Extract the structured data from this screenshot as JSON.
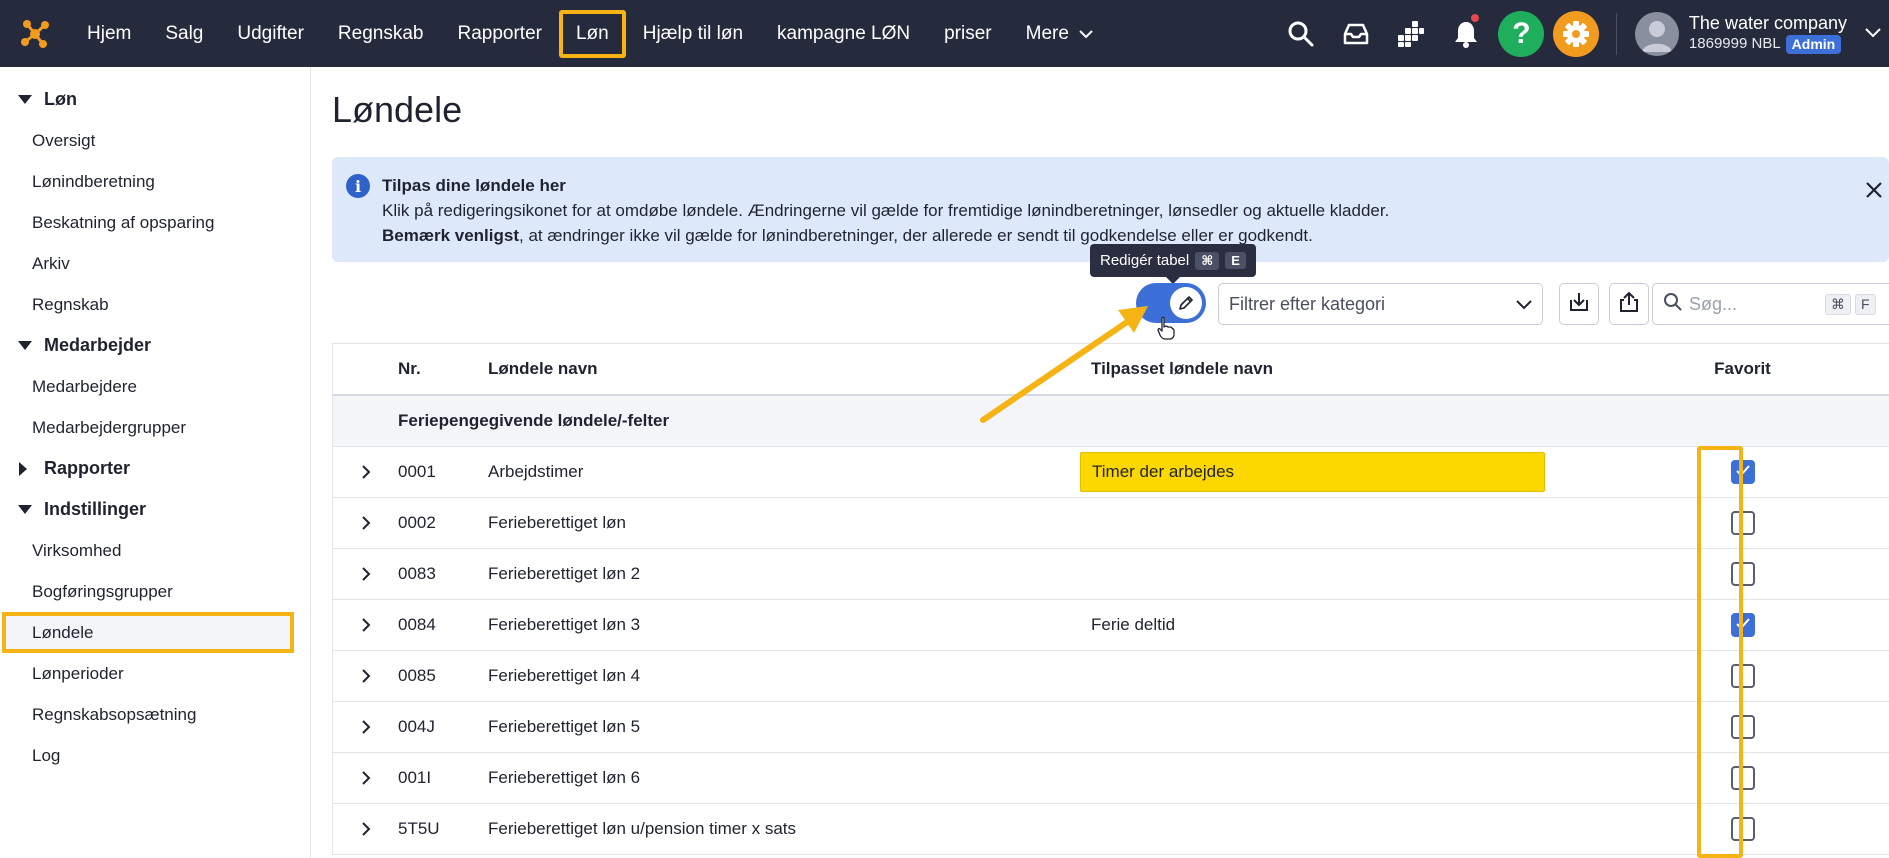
{
  "nav": {
    "items": [
      {
        "label": "Hjem"
      },
      {
        "label": "Salg"
      },
      {
        "label": "Udgifter"
      },
      {
        "label": "Regnskab"
      },
      {
        "label": "Rapporter"
      },
      {
        "label": "Løn",
        "active": true
      },
      {
        "label": "Hjælp til løn"
      },
      {
        "label": "kampagne LØN"
      },
      {
        "label": "priser"
      },
      {
        "label": "Mere"
      }
    ],
    "company_name": "The water company",
    "company_id": "1869999 NBL",
    "role_badge": "Admin",
    "colors": {
      "bar": "#262a3d",
      "help": "#1fae5b",
      "settings": "#f29c1f",
      "highlight": "#f5b414"
    }
  },
  "sidebar": {
    "sections": [
      {
        "label": "Løn",
        "expanded": true,
        "items": [
          "Oversigt",
          "Lønindberetning",
          "Beskatning af opsparing",
          "Arkiv",
          "Regnskab"
        ]
      },
      {
        "label": "Medarbejder",
        "expanded": true,
        "items": [
          "Medarbejdere",
          "Medarbejdergrupper"
        ]
      },
      {
        "label": "Rapporter",
        "expanded": false,
        "items": []
      },
      {
        "label": "Indstillinger",
        "expanded": true,
        "items": [
          "Virksomhed",
          "Bogføringsgrupper",
          "Løndele",
          "Lønperioder",
          "Regnskabsopsætning",
          "Log"
        ]
      }
    ],
    "active_item": "Løndele"
  },
  "page": {
    "title": "Løndele"
  },
  "info": {
    "heading": "Tilpas dine løndele her",
    "line1": "Klik på redigeringsikonet for at omdøbe løndele. Ændringerne vil gælde for fremtidige lønindberetninger, lønsedler og aktuelle kladder.",
    "note_bold": "Bemærk venligst",
    "note_rest": ", at ændringer ikke vil gælde for lønindberetninger, der allerede er sendt til godkendelse eller er godkendt."
  },
  "toolbar": {
    "tooltip": "Redigér tabel",
    "tooltip_key1": "⌘",
    "tooltip_key2": "E",
    "edit_toggle_on": true,
    "filter_placeholder": "Filtrer efter kategori",
    "search_placeholder": "Søg...",
    "search_key1": "⌘",
    "search_key2": "F"
  },
  "table": {
    "headers": {
      "nr": "Nr.",
      "name": "Løndele navn",
      "custom": "Tilpasset løndele navn",
      "fav": "Favorit"
    },
    "group": "Feriepengegivende løndele/-felter",
    "rows": [
      {
        "nr": "0001",
        "name": "Arbejdstimer",
        "custom": "Timer der arbejdes",
        "fav": true,
        "editing": true
      },
      {
        "nr": "0002",
        "name": "Ferieberettiget løn",
        "custom": "",
        "fav": false
      },
      {
        "nr": "0083",
        "name": "Ferieberettiget løn 2",
        "custom": "",
        "fav": false
      },
      {
        "nr": "0084",
        "name": "Ferieberettiget løn 3",
        "custom": "Ferie deltid",
        "fav": true
      },
      {
        "nr": "0085",
        "name": "Ferieberettiget løn 4",
        "custom": "",
        "fav": false
      },
      {
        "nr": "004J",
        "name": "Ferieberettiget løn 5",
        "custom": "",
        "fav": false
      },
      {
        "nr": "001I",
        "name": "Ferieberettiget løn 6",
        "custom": "",
        "fav": false
      },
      {
        "nr": "5T5U",
        "name": "Ferieberettiget løn u/pension timer x sats",
        "custom": "",
        "fav": false
      }
    ]
  }
}
